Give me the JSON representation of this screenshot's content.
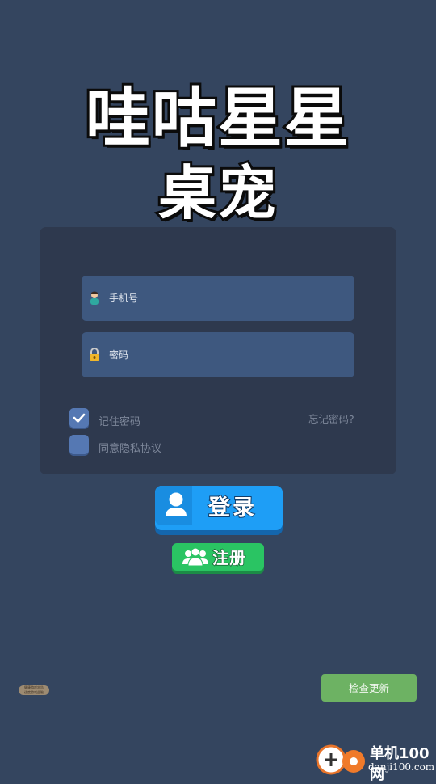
{
  "title": {
    "line1": "哇咕星星",
    "line2": "桌宠"
  },
  "login_form": {
    "phone": {
      "placeholder": "手机号",
      "icon": "user-icon"
    },
    "password": {
      "placeholder": "密码",
      "icon": "lock-icon"
    },
    "remember_password": {
      "label": "记住密码",
      "checked": true
    },
    "agree_privacy": {
      "label": "同意隐私协议",
      "checked": false
    },
    "forgot_password": "忘记密码?"
  },
  "buttons": {
    "login": "登录",
    "register": "注册",
    "check_update": "检查更新"
  },
  "badge": {
    "line1": "健康游戏忠告",
    "line2": "适度游戏益脑"
  },
  "watermark": {
    "name": "单机100网",
    "url": "danji100.com"
  },
  "colors": {
    "background": "#34455f",
    "panel": "#2e394e",
    "input": "#3e587f",
    "login_button": "#1e9ef6",
    "register_button": "#2ac463",
    "update_button": "#6db263"
  }
}
